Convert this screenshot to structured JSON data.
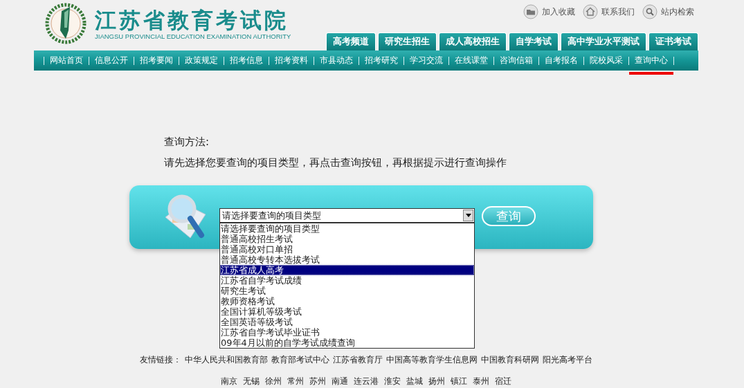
{
  "header": {
    "title": "江苏省教育考试院",
    "subtitle": "JIANGSU PROVINCIAL EDUCATION EXAMINATION AUTHORITY",
    "top_links": [
      {
        "kind": "folder",
        "label": "加入收藏"
      },
      {
        "kind": "home",
        "label": "联系我们"
      },
      {
        "kind": "search",
        "label": "站内检索"
      }
    ],
    "channel_tabs": [
      "高考频道",
      "研究生招生",
      "成人高校招生",
      "自学考试",
      "高中学业水平测试",
      "证书考试"
    ]
  },
  "nav": [
    {
      "label": "网站首页",
      "selected": false
    },
    {
      "label": "信息公开",
      "selected": false
    },
    {
      "label": "招考要闻",
      "selected": false
    },
    {
      "label": "政策规定",
      "selected": false
    },
    {
      "label": "招考信息",
      "selected": false
    },
    {
      "label": "招考资料",
      "selected": false
    },
    {
      "label": "市县动态",
      "selected": false
    },
    {
      "label": "招考研究",
      "selected": false
    },
    {
      "label": "学习交流",
      "selected": false
    },
    {
      "label": "在线课堂",
      "selected": false
    },
    {
      "label": "咨询信箱",
      "selected": false
    },
    {
      "label": "自考报名",
      "selected": false
    },
    {
      "label": "院校风采",
      "selected": false
    },
    {
      "label": "查询中心",
      "selected": true
    }
  ],
  "instructions": {
    "heading": "查询方法:",
    "text": "请先选择您要查询的项目类型，再点击查询按钮，再根据提示进行查询操作"
  },
  "query": {
    "select_value": "请选择要查询的项目类型",
    "button": "查询",
    "options": [
      {
        "label": "请选择要查询的项目类型",
        "selected": false
      },
      {
        "label": "普通高校招生考试",
        "selected": false
      },
      {
        "label": "普通高校对口单招",
        "selected": false
      },
      {
        "label": "普通高校专转本选拔考试",
        "selected": false
      },
      {
        "label": "江苏省成人高考",
        "selected": true
      },
      {
        "label": "江苏省自学考试成绩",
        "selected": false
      },
      {
        "label": "研究生考试",
        "selected": false
      },
      {
        "label": "教师资格考试",
        "selected": false
      },
      {
        "label": "全国计算机等级考试",
        "selected": false
      },
      {
        "label": "全国英语等级考试",
        "selected": false
      },
      {
        "label": "江苏省自学考试毕业证书",
        "selected": false
      },
      {
        "label": "09年4月以前的自学考试成绩查询",
        "selected": false
      }
    ]
  },
  "footer": {
    "links_label": "友情链接：",
    "links": [
      "中华人民共和国教育部",
      "教育部考试中心",
      "江苏省教育厅",
      "中国高等教育学生信息网",
      "中国教育科研网",
      "阳光高考平台"
    ],
    "cities": [
      "南京",
      "无锡",
      "徐州",
      "常州",
      "苏州",
      "南通",
      "连云港",
      "淮安",
      "盐城",
      "扬州",
      "镇江",
      "泰州",
      "宿迁"
    ]
  }
}
